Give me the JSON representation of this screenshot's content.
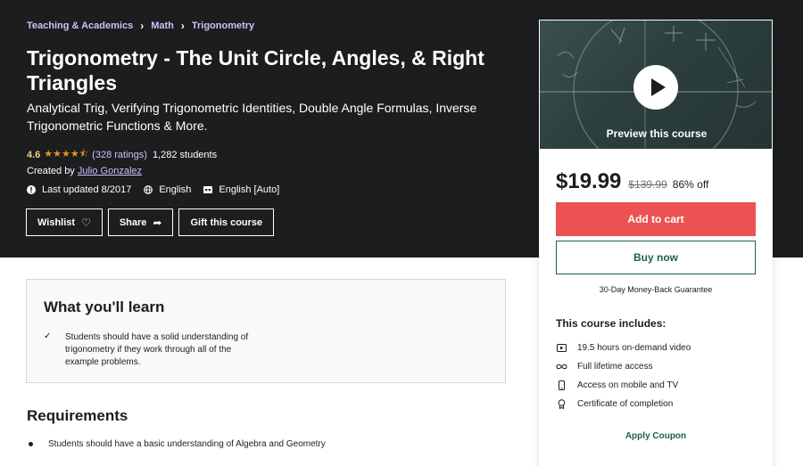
{
  "breadcrumb": [
    "Teaching & Academics",
    "Math",
    "Trigonometry"
  ],
  "course": {
    "title": "Trigonometry - The Unit Circle, Angles, & Right Triangles",
    "subtitle": "Analytical Trig, Verifying Trigonometric Identities, Double Angle Formulas, Inverse Trigonometric Functions & More.",
    "rating_value": "4.6",
    "rating_stars": 4.6,
    "rating_count": "(328 ratings)",
    "students": "1,282 students",
    "created_by_label": "Created by",
    "author": "Julio Gonzalez",
    "last_updated": "Last updated 8/2017",
    "language": "English",
    "captions": "English [Auto]"
  },
  "buttons": {
    "wishlist": "Wishlist",
    "share": "Share",
    "gift": "Gift this course"
  },
  "sidebar": {
    "preview_label": "Preview this course",
    "price": "$19.99",
    "original_price": "$139.99",
    "discount": "86% off",
    "add_to_cart": "Add to cart",
    "buy_now": "Buy now",
    "guarantee": "30-Day Money-Back Guarantee",
    "includes_title": "This course includes:",
    "includes": [
      {
        "icon": "video-icon",
        "text": "19.5 hours on-demand video"
      },
      {
        "icon": "infinity-icon",
        "text": "Full lifetime access"
      },
      {
        "icon": "mobile-icon",
        "text": "Access on mobile and TV"
      },
      {
        "icon": "certificate-icon",
        "text": "Certificate of completion"
      }
    ],
    "apply_coupon": "Apply Coupon"
  },
  "learn": {
    "title": "What you'll learn",
    "items": [
      "Students should have a solid understanding of trigonometry if they work through all of the example problems."
    ]
  },
  "requirements": {
    "title": "Requirements",
    "items": [
      "Students should have a basic understanding of Algebra and Geometry"
    ]
  },
  "colors": {
    "hero_bg": "#1c1d1f",
    "link_purple": "#cec0fc",
    "star": "#e59819",
    "cart_red": "#ec5252",
    "buy_teal": "#1e6055"
  }
}
